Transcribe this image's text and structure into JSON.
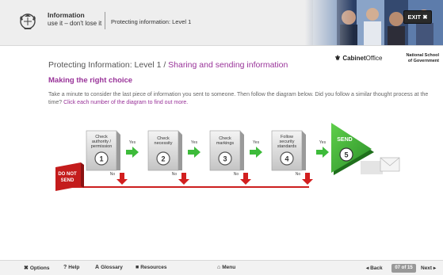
{
  "header": {
    "title": "Information",
    "subtitle": "use it – don't lose it",
    "course": "Protecting information: Level 1",
    "exit_label": "EXIT ✖"
  },
  "section": {
    "level": "Protecting Information: Level 1 / ",
    "topic": "Sharing and sending information"
  },
  "logos": {
    "cabinet_prefix": "Cabinet",
    "cabinet_suffix": "Office",
    "nsg_line1": "National School",
    "nsg_line2": "of Government"
  },
  "heading": "Making the right choice",
  "instruction": {
    "text": "Take a minute to consider the last piece of information you sent to someone. Then follow the diagram below. Did you follow a similar thought process at the time? ",
    "link": "Click each number of the diagram to find out more."
  },
  "diagram": {
    "do_not_send": [
      "DO NOT",
      "SEND"
    ],
    "steps": [
      {
        "number": "1",
        "lines": [
          "Check",
          "authority /",
          "permission"
        ],
        "yes": "Yes",
        "no": "No"
      },
      {
        "number": "2",
        "lines": [
          "Check",
          "necessity"
        ],
        "yes": "Yes",
        "no": "No"
      },
      {
        "number": "3",
        "lines": [
          "Check",
          "markings"
        ],
        "yes": "Yes",
        "no": "No"
      },
      {
        "number": "4",
        "lines": [
          "Follow",
          "security",
          "standards"
        ],
        "yes": "Yes",
        "no": "No"
      }
    ],
    "send": {
      "label": "SEND",
      "number": "5"
    }
  },
  "footer": {
    "options": "Options",
    "help": "Help",
    "glossary": "Glossary",
    "resources": "Resources",
    "menu": "Menu",
    "back": "◂ Back",
    "page": "07 of 15",
    "next": "Next ▸"
  },
  "colors": {
    "accent": "#993399",
    "send_green": "#3aa535",
    "stop_red": "#cc1f1f",
    "arrow_green": "#3dbb3a"
  }
}
